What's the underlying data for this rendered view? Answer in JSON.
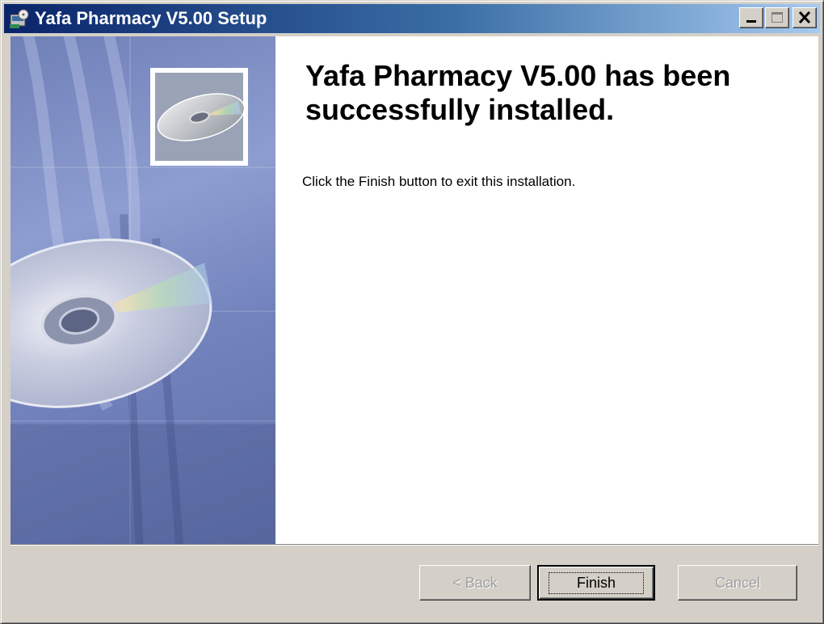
{
  "window": {
    "title": "Yafa Pharmacy V5.00 Setup"
  },
  "titlebar_buttons": {
    "minimize_icon": "minimize-icon",
    "maximize_icon": "maximize-icon",
    "close_icon": "close-icon"
  },
  "content": {
    "heading": "Yafa Pharmacy V5.00 has been successfully installed.",
    "body": "Click the Finish button to exit this installation."
  },
  "buttons": {
    "back_label": "< Back",
    "finish_label": "Finish",
    "cancel_label": "Cancel"
  },
  "colors": {
    "title_bar_start": "#0a246a",
    "title_bar_end": "#a6caf0",
    "dialog_face": "#d4d0c8",
    "banner_blue": "#7383bd"
  }
}
